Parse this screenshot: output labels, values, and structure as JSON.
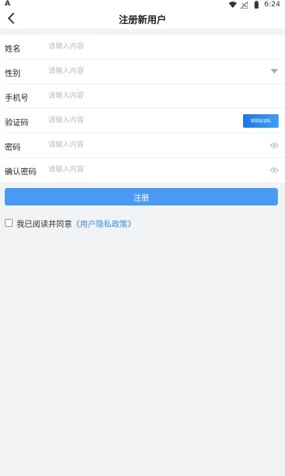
{
  "status_bar": {
    "left_label": "A",
    "time": "6:24",
    "icons": [
      "wifi-icon",
      "no-signal-icon",
      "battery-icon"
    ]
  },
  "header": {
    "title": "注册新用户",
    "back_icon": "chevron-left-icon"
  },
  "form": {
    "fields": [
      {
        "label": "姓名",
        "placeholder": "请输入内容",
        "value": ""
      },
      {
        "label": "性别",
        "placeholder": "请输入内容",
        "value": "",
        "icon": "caret-down-icon"
      },
      {
        "label": "手机号",
        "placeholder": "请输入内容",
        "value": ""
      },
      {
        "label": "验证码",
        "placeholder": "请输入内容",
        "value": "",
        "button": "获取验证码"
      },
      {
        "label": "密码",
        "placeholder": "请输入内容",
        "value": "",
        "icon": "eye-icon"
      },
      {
        "label": "确认密码",
        "placeholder": "请输入内容",
        "value": "",
        "icon": "eye-icon"
      }
    ]
  },
  "submit": {
    "label": "注册"
  },
  "agreement": {
    "text": "我已阅读并同意",
    "link": "《用户隐私政策》",
    "checked": false
  },
  "colors": {
    "primary": "#4a9af5",
    "link": "#3a8fe8",
    "background": "#f2f3f5"
  }
}
